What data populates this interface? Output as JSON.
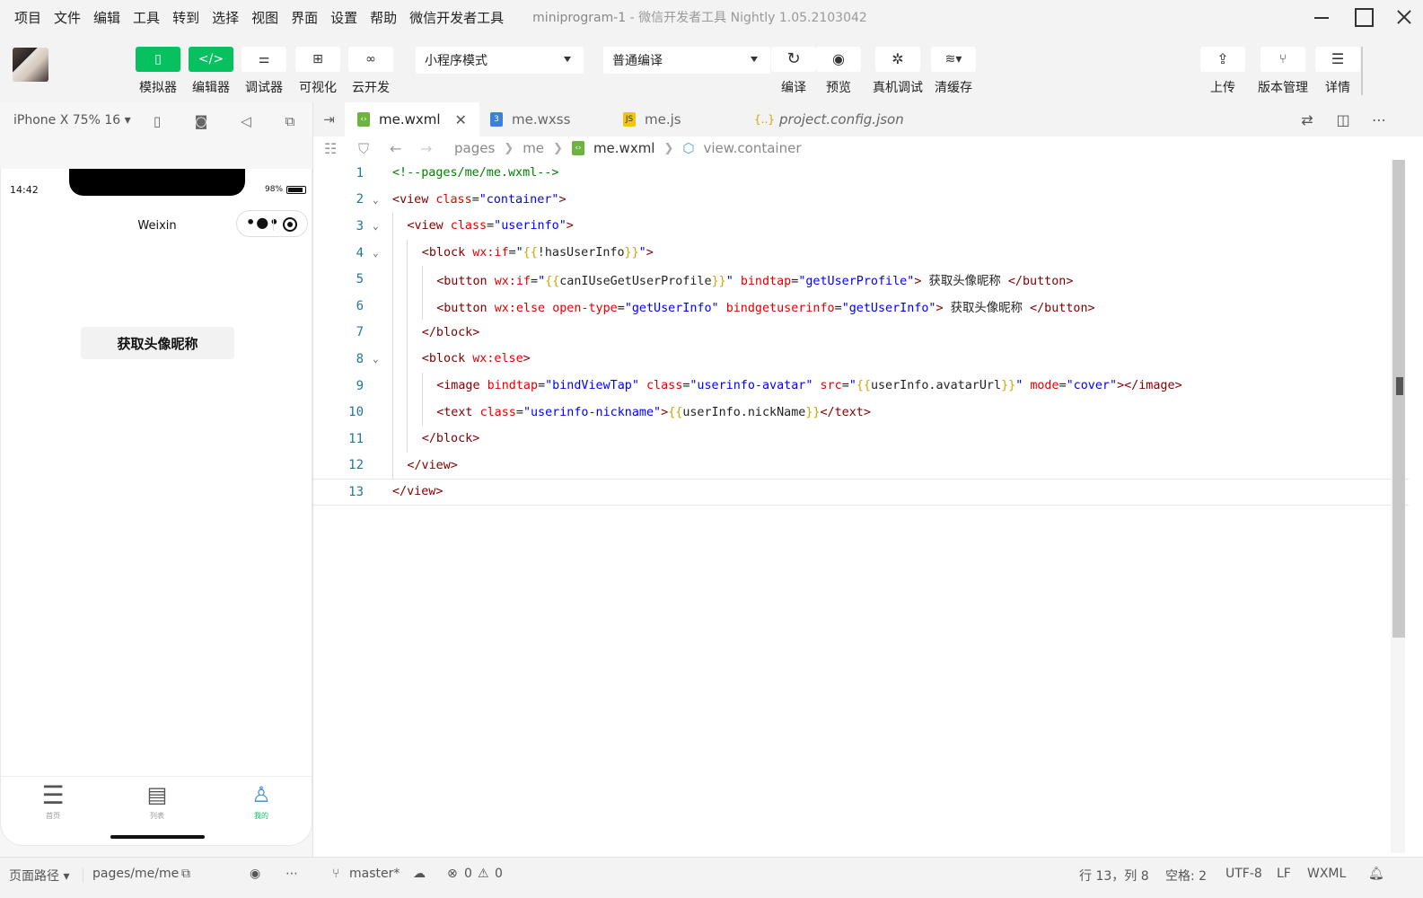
{
  "menu": [
    "项目",
    "文件",
    "编辑",
    "工具",
    "转到",
    "选择",
    "视图",
    "界面",
    "设置",
    "帮助",
    "微信开发者工具"
  ],
  "window": {
    "project": "miniprogram-1",
    "sep": "-",
    "app_name": "微信开发者工具 Nightly 1.05.2103042"
  },
  "toolbar": {
    "simulator": "模拟器",
    "editor": "编辑器",
    "debugger": "调试器",
    "visual": "可视化",
    "cloud": "云开发",
    "mode_select": "小程序模式",
    "compile_select": "普通编译",
    "compile": "编译",
    "preview": "预览",
    "remote_debug": "真机调试",
    "clear_cache": "清缓存",
    "upload": "上传",
    "version": "版本管理",
    "details": "详情"
  },
  "simulator": {
    "device": "iPhone X 75% 16 ▾",
    "time": "14:42",
    "battery": "98%",
    "nav_title": "Weixin",
    "button_label": "获取头像昵称",
    "tabs": [
      {
        "label": "首页",
        "icon": "list-icon",
        "active": false
      },
      {
        "label": "列表",
        "icon": "document-icon",
        "active": false
      },
      {
        "label": "我的",
        "icon": "user-icon",
        "active": true
      }
    ]
  },
  "editor": {
    "tabs": [
      {
        "label": "me.wxml",
        "type": "wxml",
        "active": true
      },
      {
        "label": "me.wxss",
        "type": "wxss",
        "active": false
      },
      {
        "label": "me.js",
        "type": "js",
        "active": false
      },
      {
        "label": "project.config.json",
        "type": "json",
        "active": false
      }
    ],
    "breadcrumb": [
      "pages",
      "me",
      "me.wxml",
      "view.container"
    ],
    "lines": [
      {
        "n": "1",
        "indent": 0,
        "fold": false,
        "tokens": [
          [
            "cmt",
            "<!--pages/me/me.wxml-->"
          ]
        ]
      },
      {
        "n": "2",
        "indent": 0,
        "fold": true,
        "tokens": [
          [
            "punct",
            "<"
          ],
          [
            "tag",
            "view"
          ],
          [
            "plain",
            " "
          ],
          [
            "attr",
            "class"
          ],
          [
            "plain",
            "="
          ],
          [
            "str",
            "\"container\""
          ],
          [
            "punct",
            ">"
          ]
        ]
      },
      {
        "n": "3",
        "indent": 1,
        "fold": true,
        "tokens": [
          [
            "punct",
            "<"
          ],
          [
            "tag",
            "view"
          ],
          [
            "plain",
            " "
          ],
          [
            "attr",
            "class"
          ],
          [
            "plain",
            "="
          ],
          [
            "str",
            "\"userinfo\""
          ],
          [
            "punct",
            ">"
          ]
        ]
      },
      {
        "n": "4",
        "indent": 2,
        "fold": true,
        "tokens": [
          [
            "punct",
            "<"
          ],
          [
            "tag",
            "block"
          ],
          [
            "plain",
            " "
          ],
          [
            "attr",
            "wx:if"
          ],
          [
            "plain",
            "="
          ],
          [
            "str",
            "\""
          ],
          [
            "brace",
            "{{"
          ],
          [
            "var",
            "!hasUserInfo"
          ],
          [
            "brace",
            "}}"
          ],
          [
            "str",
            "\""
          ],
          [
            "punct",
            ">"
          ]
        ]
      },
      {
        "n": "5",
        "indent": 3,
        "fold": false,
        "tokens": [
          [
            "punct",
            "<"
          ],
          [
            "tag",
            "button"
          ],
          [
            "plain",
            " "
          ],
          [
            "attr",
            "wx:if"
          ],
          [
            "plain",
            "="
          ],
          [
            "str",
            "\""
          ],
          [
            "brace",
            "{{"
          ],
          [
            "var",
            "canIUseGetUserProfile"
          ],
          [
            "brace",
            "}}"
          ],
          [
            "str",
            "\""
          ],
          [
            "plain",
            " "
          ],
          [
            "attr",
            "bindtap"
          ],
          [
            "plain",
            "="
          ],
          [
            "str",
            "\"getUserProfile\""
          ],
          [
            "punct",
            ">"
          ],
          [
            "plain",
            " 获取头像昵称 "
          ],
          [
            "punct",
            "</"
          ],
          [
            "tag",
            "button"
          ],
          [
            "punct",
            ">"
          ]
        ]
      },
      {
        "n": "6",
        "indent": 3,
        "fold": false,
        "tokens": [
          [
            "punct",
            "<"
          ],
          [
            "tag",
            "button"
          ],
          [
            "plain",
            " "
          ],
          [
            "attr",
            "wx:else"
          ],
          [
            "plain",
            " "
          ],
          [
            "attr",
            "open-type"
          ],
          [
            "plain",
            "="
          ],
          [
            "str",
            "\"getUserInfo\""
          ],
          [
            "plain",
            " "
          ],
          [
            "attr",
            "bindgetuserinfo"
          ],
          [
            "plain",
            "="
          ],
          [
            "str",
            "\"getUserInfo\""
          ],
          [
            "punct",
            ">"
          ],
          [
            "plain",
            " 获取头像昵称 "
          ],
          [
            "punct",
            "</"
          ],
          [
            "tag",
            "button"
          ],
          [
            "punct",
            ">"
          ]
        ]
      },
      {
        "n": "7",
        "indent": 2,
        "fold": false,
        "tokens": [
          [
            "punct",
            "</"
          ],
          [
            "tag",
            "block"
          ],
          [
            "punct",
            ">"
          ]
        ]
      },
      {
        "n": "8",
        "indent": 2,
        "fold": true,
        "tokens": [
          [
            "punct",
            "<"
          ],
          [
            "tag",
            "block"
          ],
          [
            "plain",
            " "
          ],
          [
            "attr",
            "wx:else"
          ],
          [
            "punct",
            ">"
          ]
        ]
      },
      {
        "n": "9",
        "indent": 3,
        "fold": false,
        "tokens": [
          [
            "punct",
            "<"
          ],
          [
            "tag",
            "image"
          ],
          [
            "plain",
            " "
          ],
          [
            "attr",
            "bindtap"
          ],
          [
            "plain",
            "="
          ],
          [
            "str",
            "\"bindViewTap\""
          ],
          [
            "plain",
            " "
          ],
          [
            "attr",
            "class"
          ],
          [
            "plain",
            "="
          ],
          [
            "str",
            "\"userinfo-avatar\""
          ],
          [
            "plain",
            " "
          ],
          [
            "attr",
            "src"
          ],
          [
            "plain",
            "="
          ],
          [
            "str",
            "\""
          ],
          [
            "brace",
            "{{"
          ],
          [
            "var",
            "userInfo.avatarUrl"
          ],
          [
            "brace",
            "}}"
          ],
          [
            "str",
            "\""
          ],
          [
            "plain",
            " "
          ],
          [
            "attr",
            "mode"
          ],
          [
            "plain",
            "="
          ],
          [
            "str",
            "\"cover\""
          ],
          [
            "punct",
            "></"
          ],
          [
            "tag",
            "image"
          ],
          [
            "punct",
            ">"
          ]
        ]
      },
      {
        "n": "10",
        "indent": 3,
        "fold": false,
        "tokens": [
          [
            "punct",
            "<"
          ],
          [
            "tag",
            "text"
          ],
          [
            "plain",
            " "
          ],
          [
            "attr",
            "class"
          ],
          [
            "plain",
            "="
          ],
          [
            "str",
            "\"userinfo-nickname\""
          ],
          [
            "punct",
            ">"
          ],
          [
            "brace",
            "{{"
          ],
          [
            "var",
            "userInfo.nickName"
          ],
          [
            "brace",
            "}}"
          ],
          [
            "punct",
            "</"
          ],
          [
            "tag",
            "text"
          ],
          [
            "punct",
            ">"
          ]
        ]
      },
      {
        "n": "11",
        "indent": 2,
        "fold": false,
        "tokens": [
          [
            "punct",
            "</"
          ],
          [
            "tag",
            "block"
          ],
          [
            "punct",
            ">"
          ]
        ]
      },
      {
        "n": "12",
        "indent": 1,
        "fold": false,
        "tokens": [
          [
            "punct",
            "</"
          ],
          [
            "tag",
            "view"
          ],
          [
            "punct",
            ">"
          ]
        ]
      },
      {
        "n": "13",
        "indent": 0,
        "fold": false,
        "tokens": [
          [
            "punct",
            "</"
          ],
          [
            "tag",
            "view"
          ],
          [
            "punct",
            ">"
          ]
        ]
      }
    ]
  },
  "status": {
    "page_path_label": "页面路径 ▾",
    "page_path": "pages/me/me",
    "branch": "master*",
    "errors": "0",
    "warnings": "0",
    "cursor": "行 13，列 8",
    "spaces": "空格: 2",
    "encoding": "UTF-8",
    "eol": "LF",
    "language": "WXML"
  },
  "colors": {
    "brand_green": "#07c160",
    "line_number": "#237893"
  }
}
